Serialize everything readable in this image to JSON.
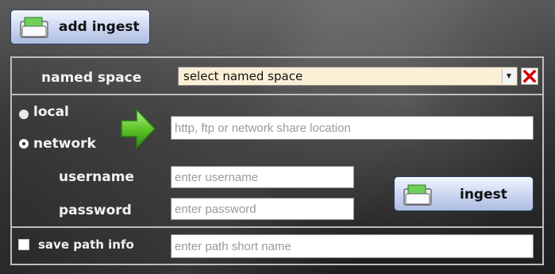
{
  "toolbar": {
    "add_ingest_label": "add ingest"
  },
  "named_space": {
    "label": "named space",
    "selected": "select named space"
  },
  "source": {
    "local_label": "local",
    "network_label": "network",
    "selected": "network",
    "location_placeholder": "http, ftp or network share location"
  },
  "credentials": {
    "username_label": "username",
    "username_placeholder": "enter username",
    "password_label": "password",
    "password_placeholder": "enter password"
  },
  "actions": {
    "ingest_label": "ingest"
  },
  "save_path": {
    "label": "save path info",
    "checked": false,
    "placeholder": "enter path short name"
  },
  "colors": {
    "select_bg": "#fcefd6",
    "close_red": "#d40000",
    "arrow_green": "#5fc42a",
    "button_blue": "#c9d5ef"
  }
}
